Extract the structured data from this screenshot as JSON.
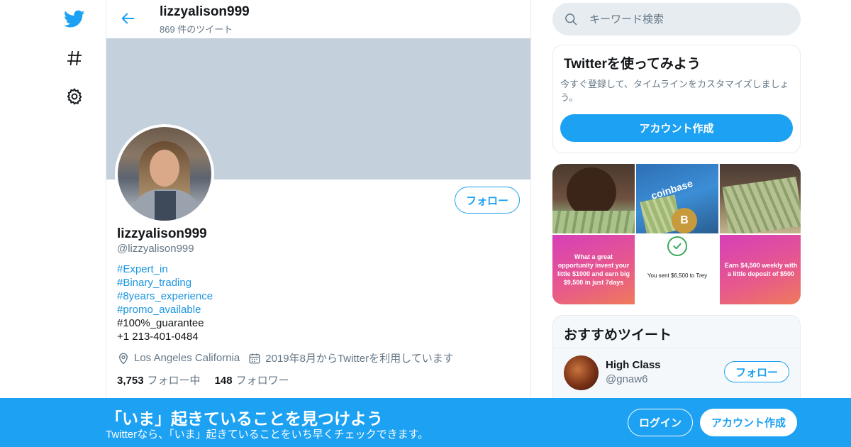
{
  "colors": {
    "accent": "#1da1f2",
    "link": "#1b95e0",
    "muted": "#657786",
    "banner": "#c4d0db"
  },
  "nav": {
    "icons": [
      "twitter-logo-icon",
      "hashtag-icon",
      "gear-icon"
    ]
  },
  "header": {
    "title": "lizzyalison999",
    "subtitle": "869 件のツイート"
  },
  "profile": {
    "follow_label": "フォロー",
    "name": "lizzyalison999",
    "handle": "@lizzyalison999",
    "bio_tags": [
      "#Expert_in",
      "#Binary_trading",
      "#8years_experience",
      "#promo_available"
    ],
    "bio_plain": [
      "#100%_guarantee",
      "+1 213-401-0484"
    ],
    "location": "Los Angeles California",
    "joined": "2019年8月からTwitterを利用しています",
    "following_count": "3,753",
    "following_label": "フォロー中",
    "followers_count": "148",
    "followers_label": "フォロワー"
  },
  "search": {
    "placeholder": "キーワード検索"
  },
  "signup_card": {
    "title": "Twitterを使ってみよう",
    "description": "今すぐ登録して、タイムラインをカスタマイズしましょう。",
    "button": "アカウント作成"
  },
  "media": {
    "coinbase_label": "coinbase",
    "bitcoin_symbol": "B",
    "tile4_text": "What a great opportunity invest your little $1000 and earn big $9,500 in just 7days",
    "tile5_text": "You sent $6,500 to Trey",
    "tile6_text": "Earn $4,500 weekly with a little deposit of $500"
  },
  "recommended": {
    "title": "おすすめツイート",
    "account_name": "High Class",
    "account_handle": "@gnaw6",
    "follow_label": "フォロー"
  },
  "bottom_bar": {
    "title": "「いま」起きていることを見つけよう",
    "subtitle": "Twitterなら、「いま」起きていることをいち早くチェックできます。",
    "login": "ログイン",
    "signup": "アカウント作成"
  }
}
